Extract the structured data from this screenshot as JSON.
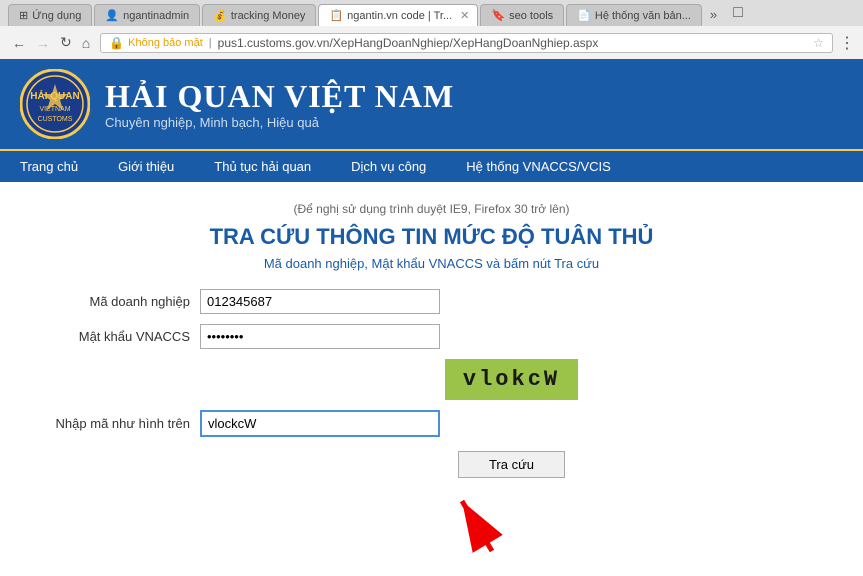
{
  "browser": {
    "back_label": "←",
    "forward_label": "→",
    "reload_label": "↻",
    "home_label": "⌂",
    "address": "pus1.customs.gov.vn/XepHangDoanNghiep/XepHangDoanNghiep.aspx",
    "address_prefix": "Không bảo mật",
    "star_label": "☆",
    "menu_label": "⋮"
  },
  "tabs": [
    {
      "label": "Ứng dụng",
      "active": false,
      "favicon": "apps"
    },
    {
      "label": "ngantinadmin",
      "active": false,
      "favicon": "person"
    },
    {
      "label": "tracking Money",
      "active": false,
      "favicon": "money"
    },
    {
      "label": "ngantin.vn code | Tr...",
      "active": true,
      "favicon": "code"
    },
    {
      "label": "seo tools",
      "active": false,
      "favicon": "seo"
    },
    {
      "label": "Hệ thống văn bản...",
      "active": false,
      "favicon": "doc"
    }
  ],
  "header": {
    "title": "HẢI QUAN VIỆT NAM",
    "subtitle": "Chuyên nghiệp, Minh bạch, Hiệu quả"
  },
  "nav": {
    "items": [
      "Trang chủ",
      "Giới thiệu",
      "Thủ tục hải quan",
      "Dịch vụ công",
      "Hệ thống VNACCS/VCIS"
    ]
  },
  "page": {
    "hint": "(Để nghị sử dụng trình duyệt IE9, Firefox 30 trở lên)",
    "title": "TRA CỨU THÔNG TIN MỨC ĐỘ TUÂN THỦ",
    "subtitle": "Mã doanh nghiệp, Mật khẩu VNACCS và bấm nút Tra cứu",
    "fields": {
      "ma_dn_label": "Mã doanh nghiệp",
      "ma_dn_value": "012345687",
      "mat_khau_label": "Mật khẩu VNACCS",
      "mat_khau_value": "••••••",
      "captcha_text": "vlokcW",
      "captcha_label": "Nhập mã như hình trên",
      "captcha_input_value": "vlockcW",
      "submit_label": "Tra cứu"
    }
  }
}
